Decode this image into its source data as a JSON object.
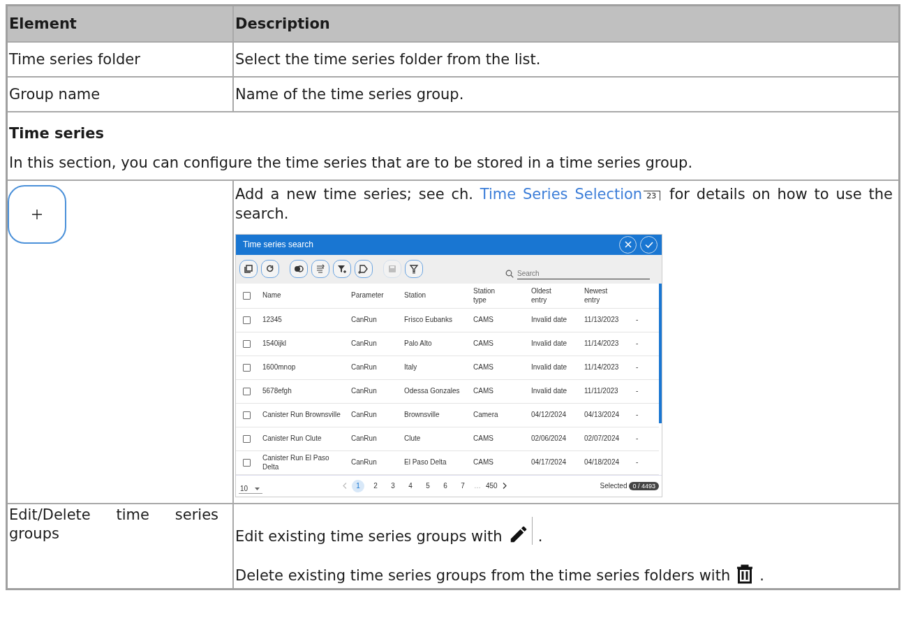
{
  "table": {
    "columns": [
      "Element",
      "Description"
    ],
    "rows": [
      {
        "kind": "plain",
        "element": "Time series folder",
        "description": "Select the time series folder from the list."
      },
      {
        "kind": "plain",
        "element": "Group name",
        "description": "Name of the time series group."
      },
      {
        "kind": "section",
        "title": "Time series",
        "text": "In this section, you can configure the time series that are to be stored in a time series group."
      },
      {
        "kind": "add",
        "before": "Add a new time series; see ch. ",
        "link": "Time Series Selection",
        "page_ref": "23",
        "after": " for details on how to use the search.",
        "screenshot": {
          "title": "Time series search",
          "header_buttons": [
            {
              "kind": "close"
            },
            {
              "kind": "confirm"
            }
          ],
          "toolbar_groups": [
            [
              {
                "kind": "copy",
                "disabled": false
              },
              {
                "kind": "refresh",
                "disabled": false
              }
            ],
            [
              {
                "kind": "toggle",
                "disabled": false
              },
              {
                "kind": "sort",
                "disabled": false
              },
              {
                "kind": "filter-add",
                "disabled": false
              },
              {
                "kind": "tag",
                "disabled": false
              }
            ],
            [
              {
                "kind": "save",
                "disabled": true
              },
              {
                "kind": "filter",
                "disabled": false
              }
            ]
          ],
          "select_all_checked": false,
          "search": {
            "placeholder": "Search"
          },
          "list_headers": [
            "Name",
            "Parameter",
            "Station",
            "Station type",
            "Oldest entry",
            "Newest entry"
          ],
          "list_items": [
            {
              "checked": false,
              "cells": [
                "12345",
                "CanRun",
                "Frisco Eubanks",
                "CAMS",
                "Invalid date",
                "11/13/2023"
              ],
              "column_7": "-"
            },
            {
              "checked": false,
              "cells": [
                "1540ijkl",
                "CanRun",
                "Palo Alto",
                "CAMS",
                "Invalid date",
                "11/14/2023"
              ],
              "column_7": "-"
            },
            {
              "checked": false,
              "cells": [
                "1600mnop",
                "CanRun",
                "Italy",
                "CAMS",
                "Invalid date",
                "11/14/2023"
              ],
              "column_7": "-"
            },
            {
              "checked": false,
              "cells": [
                "5678efgh",
                "CanRun",
                "Odessa Gonzales",
                "CAMS",
                "Invalid date",
                "11/11/2023"
              ],
              "column_7": "-"
            },
            {
              "checked": false,
              "cells": [
                "Canister Run Brownsville",
                "CanRun",
                "Brownsville",
                "Camera",
                "04/12/2024",
                "04/13/2024"
              ],
              "column_7": "-"
            },
            {
              "checked": false,
              "cells": [
                "Canister Run Clute",
                "CanRun",
                "Clute",
                "CAMS",
                "02/06/2024",
                "02/07/2024"
              ],
              "column_7": "-"
            },
            {
              "checked": false,
              "cells": [
                "Canister Run El Paso Delta",
                "CanRun",
                "El Paso Delta",
                "CAMS",
                "04/17/2024",
                "04/18/2024"
              ],
              "column_7": "-"
            }
          ],
          "footer": {
            "page_size": "10",
            "prev_disabled": true,
            "pages": [
              {
                "label": "1",
                "selected": true
              },
              {
                "label": "2",
                "selected": false
              },
              {
                "label": "3",
                "selected": false
              },
              {
                "label": "4",
                "selected": false
              },
              {
                "label": "5",
                "selected": false
              },
              {
                "label": "6",
                "selected": false
              },
              {
                "label": "7",
                "selected": false
              }
            ],
            "ellipsis": "…",
            "last_page": "450",
            "selected_label": "Selected",
            "selected_count": "0 / 4493"
          }
        }
      },
      {
        "kind": "edit_delete",
        "element": "Edit/Delete time series groups",
        "lines": [
          {
            "kind": "edit",
            "text": "Edit existing time series groups with",
            "end": "."
          },
          {
            "kind": "delete",
            "text": "Delete existing time series groups from the time series folders with",
            "end": "."
          }
        ]
      }
    ]
  }
}
